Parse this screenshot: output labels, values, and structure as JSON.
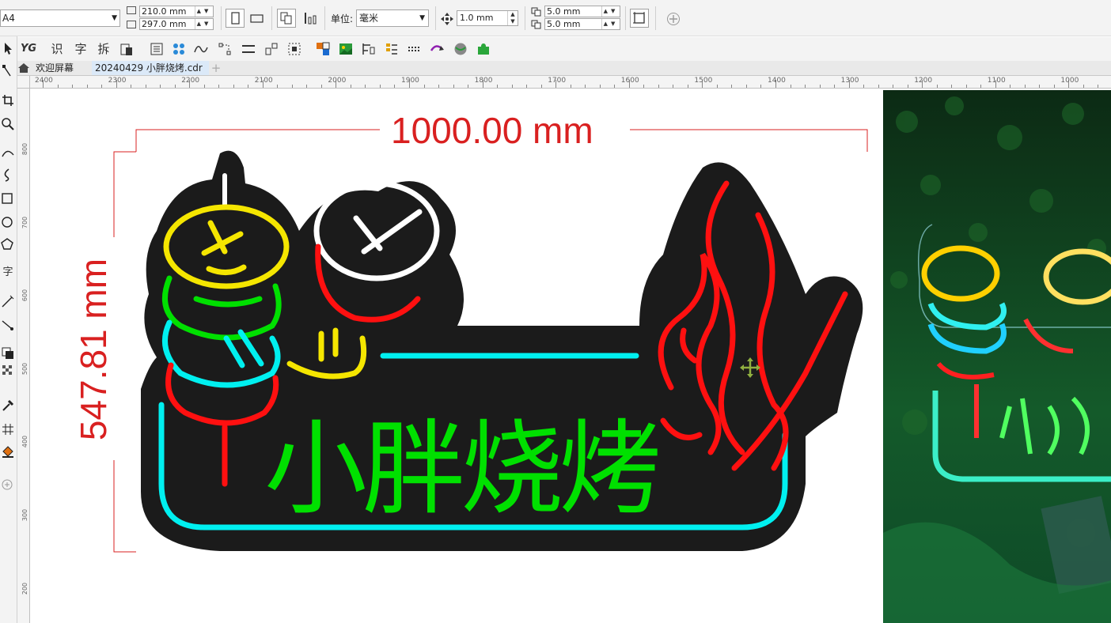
{
  "property_bar": {
    "page_size": "A4",
    "width": "210.0 mm",
    "height": "297.0 mm",
    "units_label": "单位:",
    "units_value": "毫米",
    "nudge": "1.0 mm",
    "dup_x": "5.0 mm",
    "dup_y": "5.0 mm"
  },
  "toolbar2": {
    "icon_labels": [
      "识",
      "字",
      "拆"
    ]
  },
  "tabs": [
    {
      "label": "欢迎屏幕"
    },
    {
      "label": "20240429 小胖烧烤.cdr"
    }
  ],
  "ruler": {
    "h_labels": [
      "2400",
      "2300",
      "2200",
      "2100",
      "2000",
      "1900",
      "1800",
      "1700",
      "1600",
      "1500",
      "1400",
      "1300",
      "1200",
      "1100",
      "1000"
    ],
    "v_labels": [
      "800",
      "700",
      "600",
      "500",
      "400",
      "300",
      "200"
    ]
  },
  "toolbox": {
    "text_tool": "字"
  },
  "design": {
    "width_dim": "1000.00 mm",
    "height_dim": "547.81 mm",
    "sign_text": "小胖烧烤"
  },
  "colors": {
    "dimension": "#d92020",
    "backing": "#1b1b1b",
    "neon_cyan": "#00f0f0",
    "neon_green": "#00e000",
    "neon_yellow": "#f5e600",
    "neon_red": "#ff1010",
    "neon_white": "#ffffff"
  }
}
